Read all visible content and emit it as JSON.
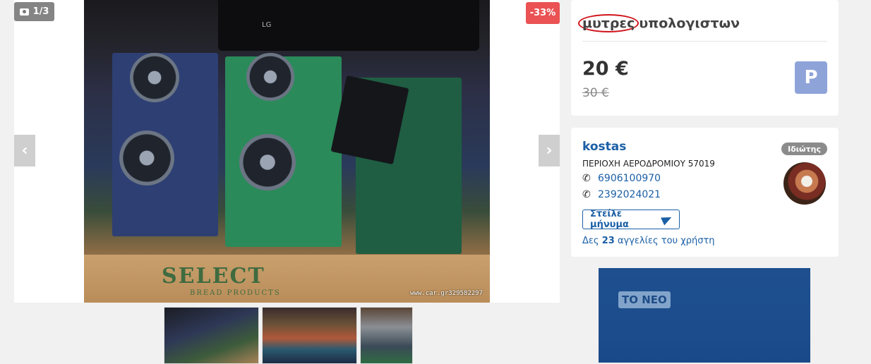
{
  "gallery": {
    "counter": "1/3",
    "discount": "-33%",
    "monitor_brand": "LG",
    "box_logo": "SELECT",
    "box_logo_sub": "BREAD PRODUCTS",
    "watermark": "www.car.gr329582297",
    "prev_icon": "chevron-left-icon",
    "next_icon": "chevron-right-icon"
  },
  "listing": {
    "title_circled": "μυτρες",
    "title_rest": "υπολογιστων",
    "price": "20 €",
    "old_price": "30 €",
    "parking_icon": "P"
  },
  "seller": {
    "name": "kostas",
    "area": "ΠΕΡΙΟΧΗ ΑΕΡΟΔΡΟΜΙΟΥ 57019",
    "phones": [
      "6906100970",
      "2392024021"
    ],
    "message_button": "Στείλε μήνυμα",
    "ads_prefix": "Δες",
    "ads_count": "23",
    "ads_suffix": "αγγελίες του χρήστη",
    "badge": "Ιδιώτης"
  },
  "ad": {
    "label": "ΤΟ ΝΕΟ"
  },
  "colors": {
    "accent_blue": "#1a5fa6",
    "discount_red": "#ea5253",
    "parking_blue": "#8ea3d8",
    "badge_gray": "#8b8b8b",
    "circle_red": "#d0141b"
  }
}
